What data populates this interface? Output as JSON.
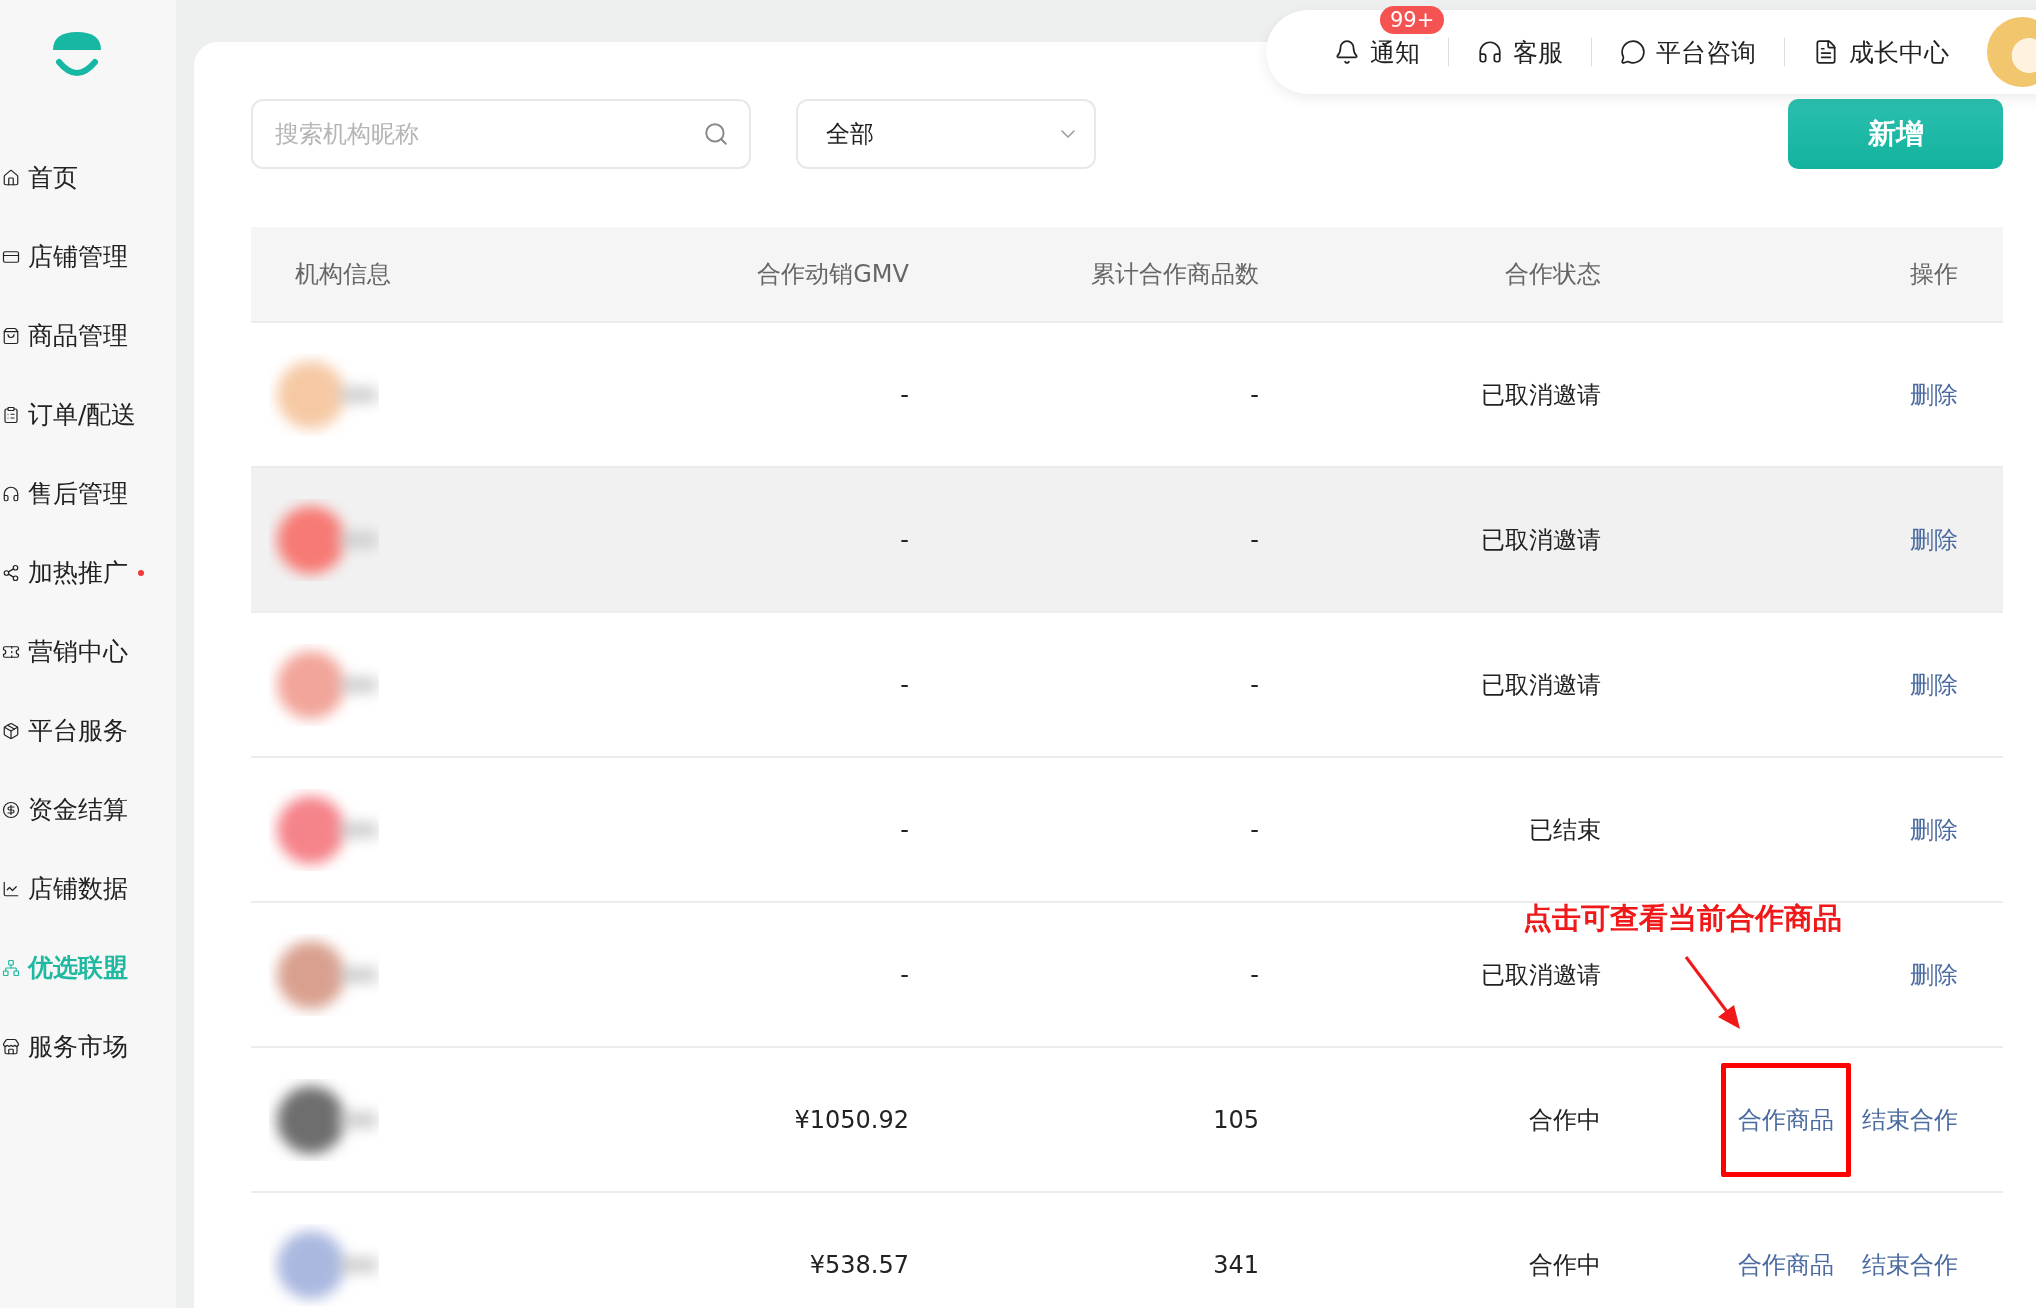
{
  "sidebar": {
    "items": [
      {
        "label": "首页",
        "selected": false,
        "dot": false
      },
      {
        "label": "店铺管理",
        "selected": false,
        "dot": false
      },
      {
        "label": "商品管理",
        "selected": false,
        "dot": false
      },
      {
        "label": "订单/配送",
        "selected": false,
        "dot": false
      },
      {
        "label": "售后管理",
        "selected": false,
        "dot": false
      },
      {
        "label": "加热推广",
        "selected": false,
        "dot": true
      },
      {
        "label": "营销中心",
        "selected": false,
        "dot": false
      },
      {
        "label": "平台服务",
        "selected": false,
        "dot": false
      },
      {
        "label": "资金结算",
        "selected": false,
        "dot": false
      },
      {
        "label": "店铺数据",
        "selected": false,
        "dot": false
      },
      {
        "label": "优选联盟",
        "selected": true,
        "dot": false
      },
      {
        "label": "服务市场",
        "selected": false,
        "dot": false
      }
    ]
  },
  "topbar": {
    "items": [
      {
        "label": "通知",
        "badge": "99+"
      },
      {
        "label": "客服"
      },
      {
        "label": "平台咨询"
      },
      {
        "label": "成长中心"
      }
    ]
  },
  "search": {
    "placeholder": "搜索机构昵称"
  },
  "filter": {
    "value": "全部"
  },
  "add_button": "新增",
  "table": {
    "columns": [
      "机构信息",
      "合作动销GMV",
      "累计合作商品数",
      "合作状态",
      "操作"
    ],
    "rows": [
      {
        "info": {
          "kind": "picture"
        },
        "gmv": "-",
        "count": "-",
        "status": "已取消邀请",
        "hovered": false,
        "actions": [
          {
            "label": "删除",
            "outlined": false
          }
        ]
      },
      {
        "info": {
          "kind": "picture"
        },
        "gmv": "-",
        "count": "-",
        "status": "已取消邀请",
        "hovered": true,
        "actions": [
          {
            "label": "删除",
            "outlined": false
          }
        ]
      },
      {
        "info": {
          "kind": "picture"
        },
        "gmv": "-",
        "count": "-",
        "status": "已取消邀请",
        "hovered": false,
        "actions": [
          {
            "label": "删除",
            "outlined": false
          }
        ]
      },
      {
        "info": {
          "kind": "picture"
        },
        "gmv": "-",
        "count": "-",
        "status": "已结束",
        "hovered": false,
        "actions": [
          {
            "label": "删除",
            "outlined": false
          }
        ]
      },
      {
        "info": {
          "kind": "picture"
        },
        "gmv": "-",
        "count": "-",
        "status": "已取消邀请",
        "hovered": false,
        "actions": [
          {
            "label": "删除",
            "outlined": false
          }
        ]
      },
      {
        "info": {
          "kind": "picture"
        },
        "gmv": "¥1050.92",
        "count": "105",
        "status": "合作中",
        "hovered": false,
        "actions": [
          {
            "label": "合作商品",
            "outlined": true
          },
          {
            "label": "结束合作",
            "outlined": false
          }
        ]
      },
      {
        "info": {
          "kind": "picture"
        },
        "gmv": "¥538.57",
        "count": "341",
        "status": "合作中",
        "hovered": false,
        "actions": [
          {
            "label": "合作商品",
            "outlined": false
          },
          {
            "label": "结束合作",
            "outlined": false
          }
        ]
      }
    ]
  },
  "annotation": {
    "text": "点击可查看当前合作商品"
  }
}
